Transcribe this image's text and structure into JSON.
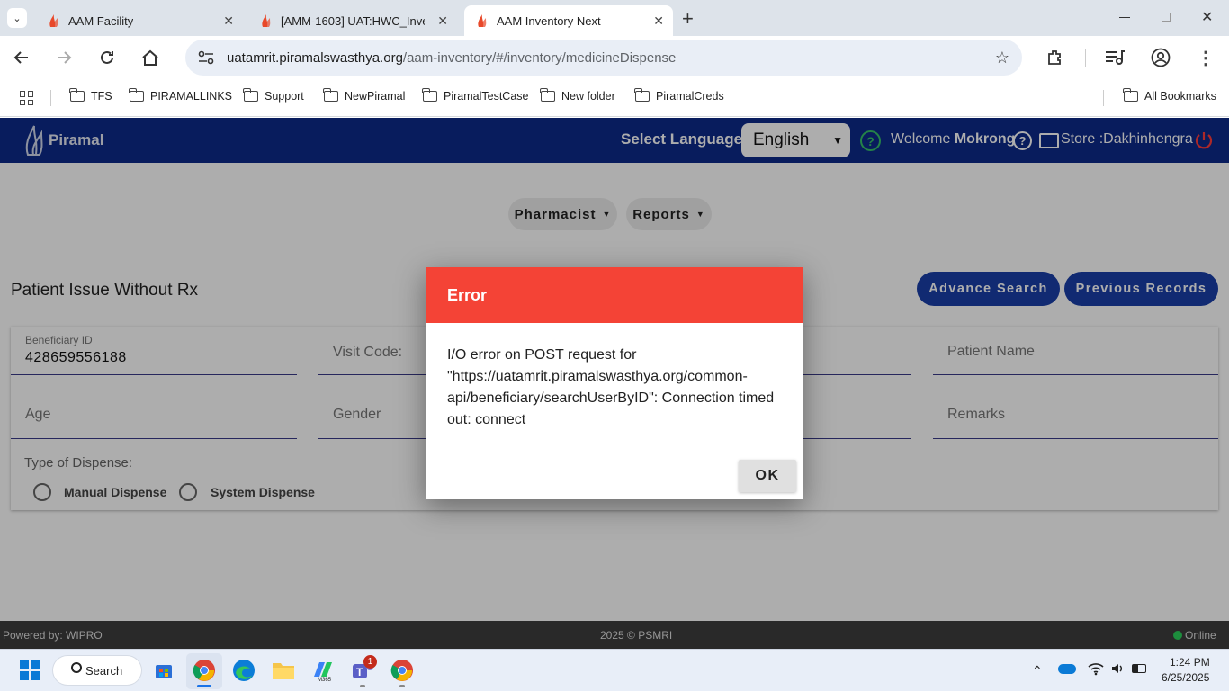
{
  "browser": {
    "tabs": [
      {
        "title": "AAM Facility",
        "active": false
      },
      {
        "title": "[AMM-1603] UAT:HWC_Inve",
        "active": false
      },
      {
        "title": "AAM Inventory Next",
        "active": true
      }
    ],
    "new_tab_symbol": "+",
    "url_host": "uatamrit.piramalswasthya.org",
    "url_path": "/aam-inventory/#/inventory/medicineDispense",
    "bookmarks": [
      "TFS",
      "PIRAMALLINKS",
      "Support",
      "NewPiramal",
      "PiramalTestCase",
      "New folder",
      "PiramalCreds"
    ],
    "all_bookmarks": "All Bookmarks"
  },
  "app": {
    "logo_text": "Piramal",
    "select_language_label": "Select Language :",
    "language_value": "English",
    "welcome_label": "Welcome",
    "user_name": "Mokrong",
    "store_label": "Store :Dakhinhengra",
    "menu": [
      "Pharmacist",
      "Reports"
    ],
    "page_title": "Patient Issue Without Rx",
    "buttons": {
      "advance_search": "Advance Search",
      "previous_records": "Previous Records"
    },
    "fields": {
      "beneficiary_id_label": "Beneficiary ID",
      "beneficiary_id_value": "428659556188",
      "visit_code_label": "Visit Code:",
      "patient_name_label": "Patient Name",
      "age_label": "Age",
      "gender_label": "Gender",
      "remarks_label": "Remarks"
    },
    "dispense": {
      "label": "Type of Dispense:",
      "options": [
        "Manual Dispense",
        "System Dispense"
      ]
    },
    "footer": {
      "powered_by": "Powered by: WIPRO",
      "copyright": "2025 © PSMRI",
      "status": "Online"
    }
  },
  "dialog": {
    "title": "Error",
    "message": "I/O error on POST request for \"https://uatamrit.piramalswasthya.org/common-api/beneficiary/searchUserByID\": Connection timed out: connect",
    "ok_label": "OK"
  },
  "taskbar": {
    "search_label": "Search",
    "teams_badge": "1",
    "time": "1:24 PM",
    "date": "6/25/2025"
  },
  "colors": {
    "header_blue": "#0d2a8a",
    "error_red": "#f44336",
    "pill_blue": "#1a3fa8"
  }
}
